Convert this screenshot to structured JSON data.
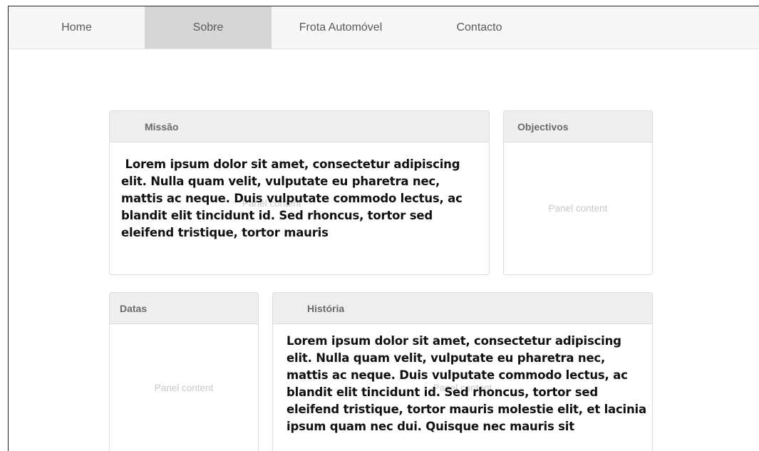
{
  "nav": {
    "items": [
      {
        "label": "Home"
      },
      {
        "label": "Sobre"
      },
      {
        "label": "Frota Automóvel"
      },
      {
        "label": "Contacto"
      }
    ],
    "active": "Sobre"
  },
  "panels": {
    "missao": {
      "title": "Missão",
      "body": " Lorem ipsum dolor sit amet, consectetur adipiscing elit. Nulla quam velit, vulputate eu pharetra nec, mattis ac neque. Duis vulputate commodo lectus, ac blandit elit tincidunt id. Sed rhoncus, tortor sed eleifend tristique, tortor mauris",
      "placeholder": "Panel content"
    },
    "objectivos": {
      "title": "Objectivos",
      "placeholder": "Panel content"
    },
    "datas": {
      "title": "Datas",
      "placeholder": "Panel content"
    },
    "historia": {
      "title": "História",
      "body": "Lorem ipsum dolor sit amet, consectetur adipiscing elit. Nulla quam velit, vulputate eu pharetra nec, mattis ac neque. Duis vulputate commodo lectus, ac blandit elit tincidunt id. Sed rhoncus, tortor sed eleifend tristique, tortor mauris molestie elit, et lacinia ipsum quam nec dui. Quisque nec mauris sit",
      "placeholder": "Panel content"
    }
  }
}
